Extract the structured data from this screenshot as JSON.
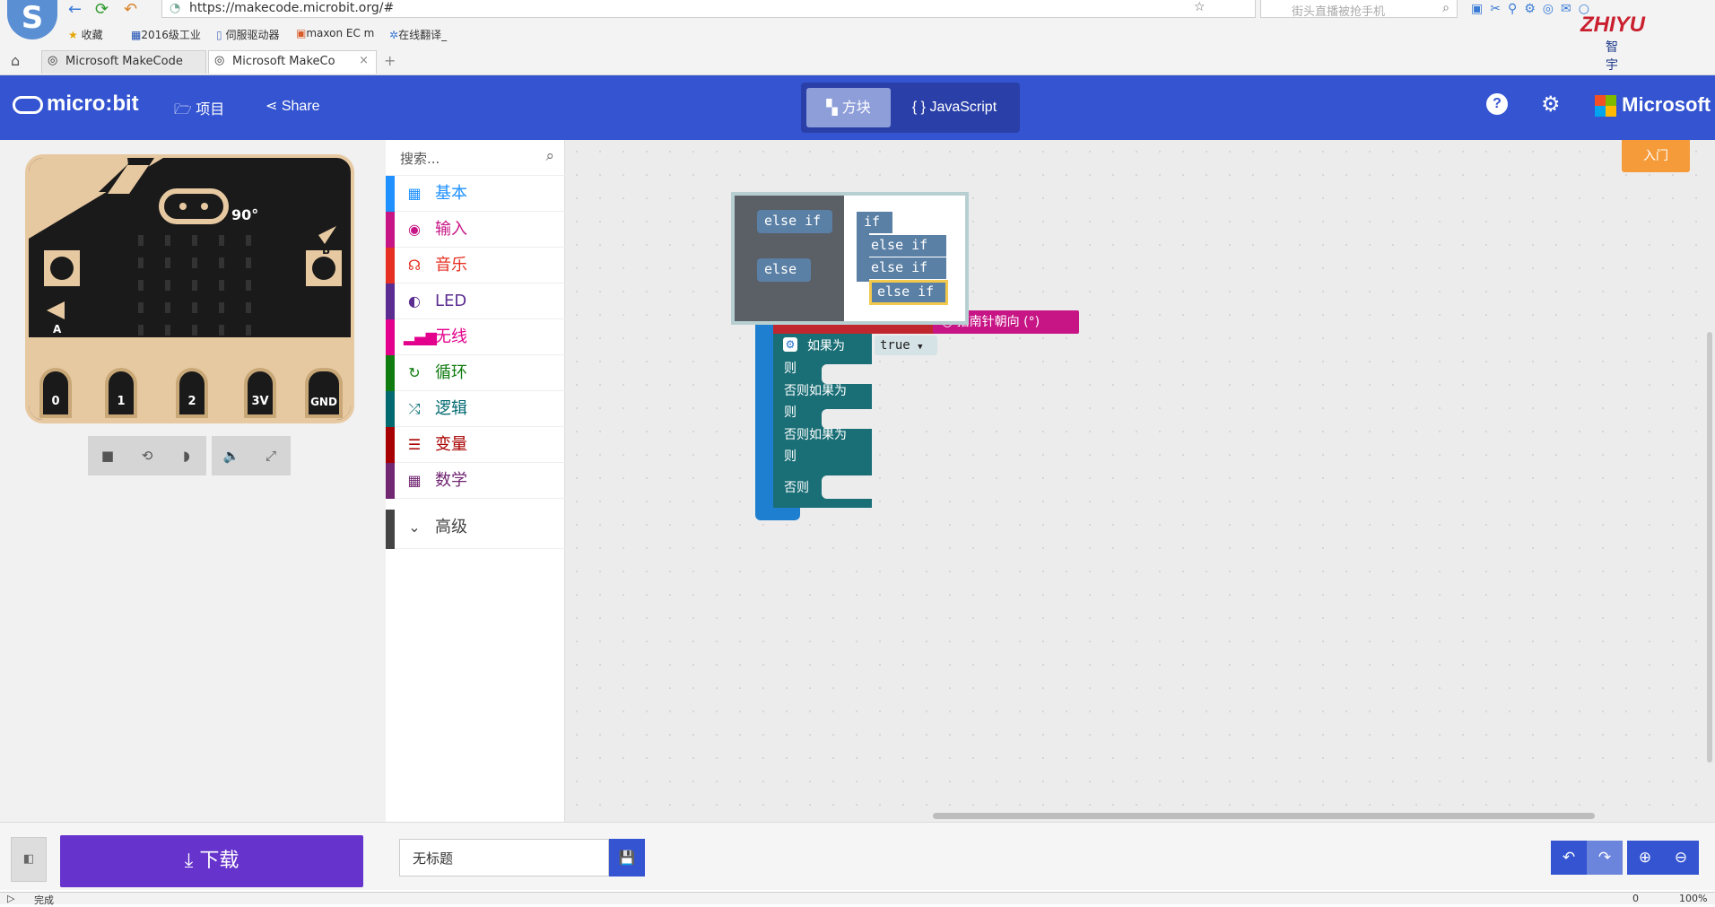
{
  "browser": {
    "url": "https://makecode.microbit.org/#",
    "search_placeholder": "街头直播被抢手机",
    "bookmarks": [
      "收藏",
      "2016级工业",
      "伺服驱动器",
      "maxon EC m",
      "在线翻译_"
    ],
    "tabs": [
      "Microsoft MakeCode",
      "Microsoft MakeCo"
    ],
    "brand_text": "ZHIYU",
    "brand_sub": "智 宇",
    "logo_char": "S"
  },
  "header": {
    "logo": "micro:bit",
    "projects_label": "项目",
    "share_label": "Share",
    "mode_blocks": "方块",
    "mode_js": "{ } JavaScript",
    "microsoft_label": "Microsoft",
    "accent": "#3454d1"
  },
  "simulator": {
    "heading_label": "90°",
    "button_a": "A",
    "button_b": "B",
    "pins": [
      "0",
      "1",
      "2",
      "3V",
      "GND"
    ]
  },
  "toolbox": {
    "search_placeholder": "搜索...",
    "categories": [
      {
        "label": "基本",
        "color": "#1e90ff",
        "icon": "grid-icon"
      },
      {
        "label": "输入",
        "color": "#c71585",
        "icon": "target-icon"
      },
      {
        "label": "音乐",
        "color": "#e63022",
        "icon": "headphones-icon"
      },
      {
        "label": "LED",
        "color": "#5c2d91",
        "icon": "toggle-icon"
      },
      {
        "label": "无线",
        "color": "#e3008c",
        "icon": "signal-icon"
      },
      {
        "label": "循环",
        "color": "#107c10",
        "icon": "refresh-icon"
      },
      {
        "label": "逻辑",
        "color": "#006970",
        "icon": "shuffle-icon"
      },
      {
        "label": "变量",
        "color": "#a80000",
        "icon": "list-icon"
      },
      {
        "label": "数学",
        "color": "#712672",
        "icon": "calculator-icon"
      }
    ],
    "advanced_label": "高级"
  },
  "workspace": {
    "intro_label": "入门",
    "mutator": {
      "left_items": [
        "else if",
        "else"
      ],
      "right_items": [
        "if",
        "else if",
        "else if",
        "else if"
      ]
    },
    "compass_label": "指南针朝向 (°)",
    "if_label": "如果为",
    "true_label": "true",
    "then_label": "则",
    "elseif_label": "否则如果为",
    "else_label": "否则"
  },
  "bottom": {
    "download_label": "下载",
    "project_name": "无标题"
  },
  "status": {
    "left_text": "完成",
    "zoom": "100%",
    "count": "0"
  }
}
